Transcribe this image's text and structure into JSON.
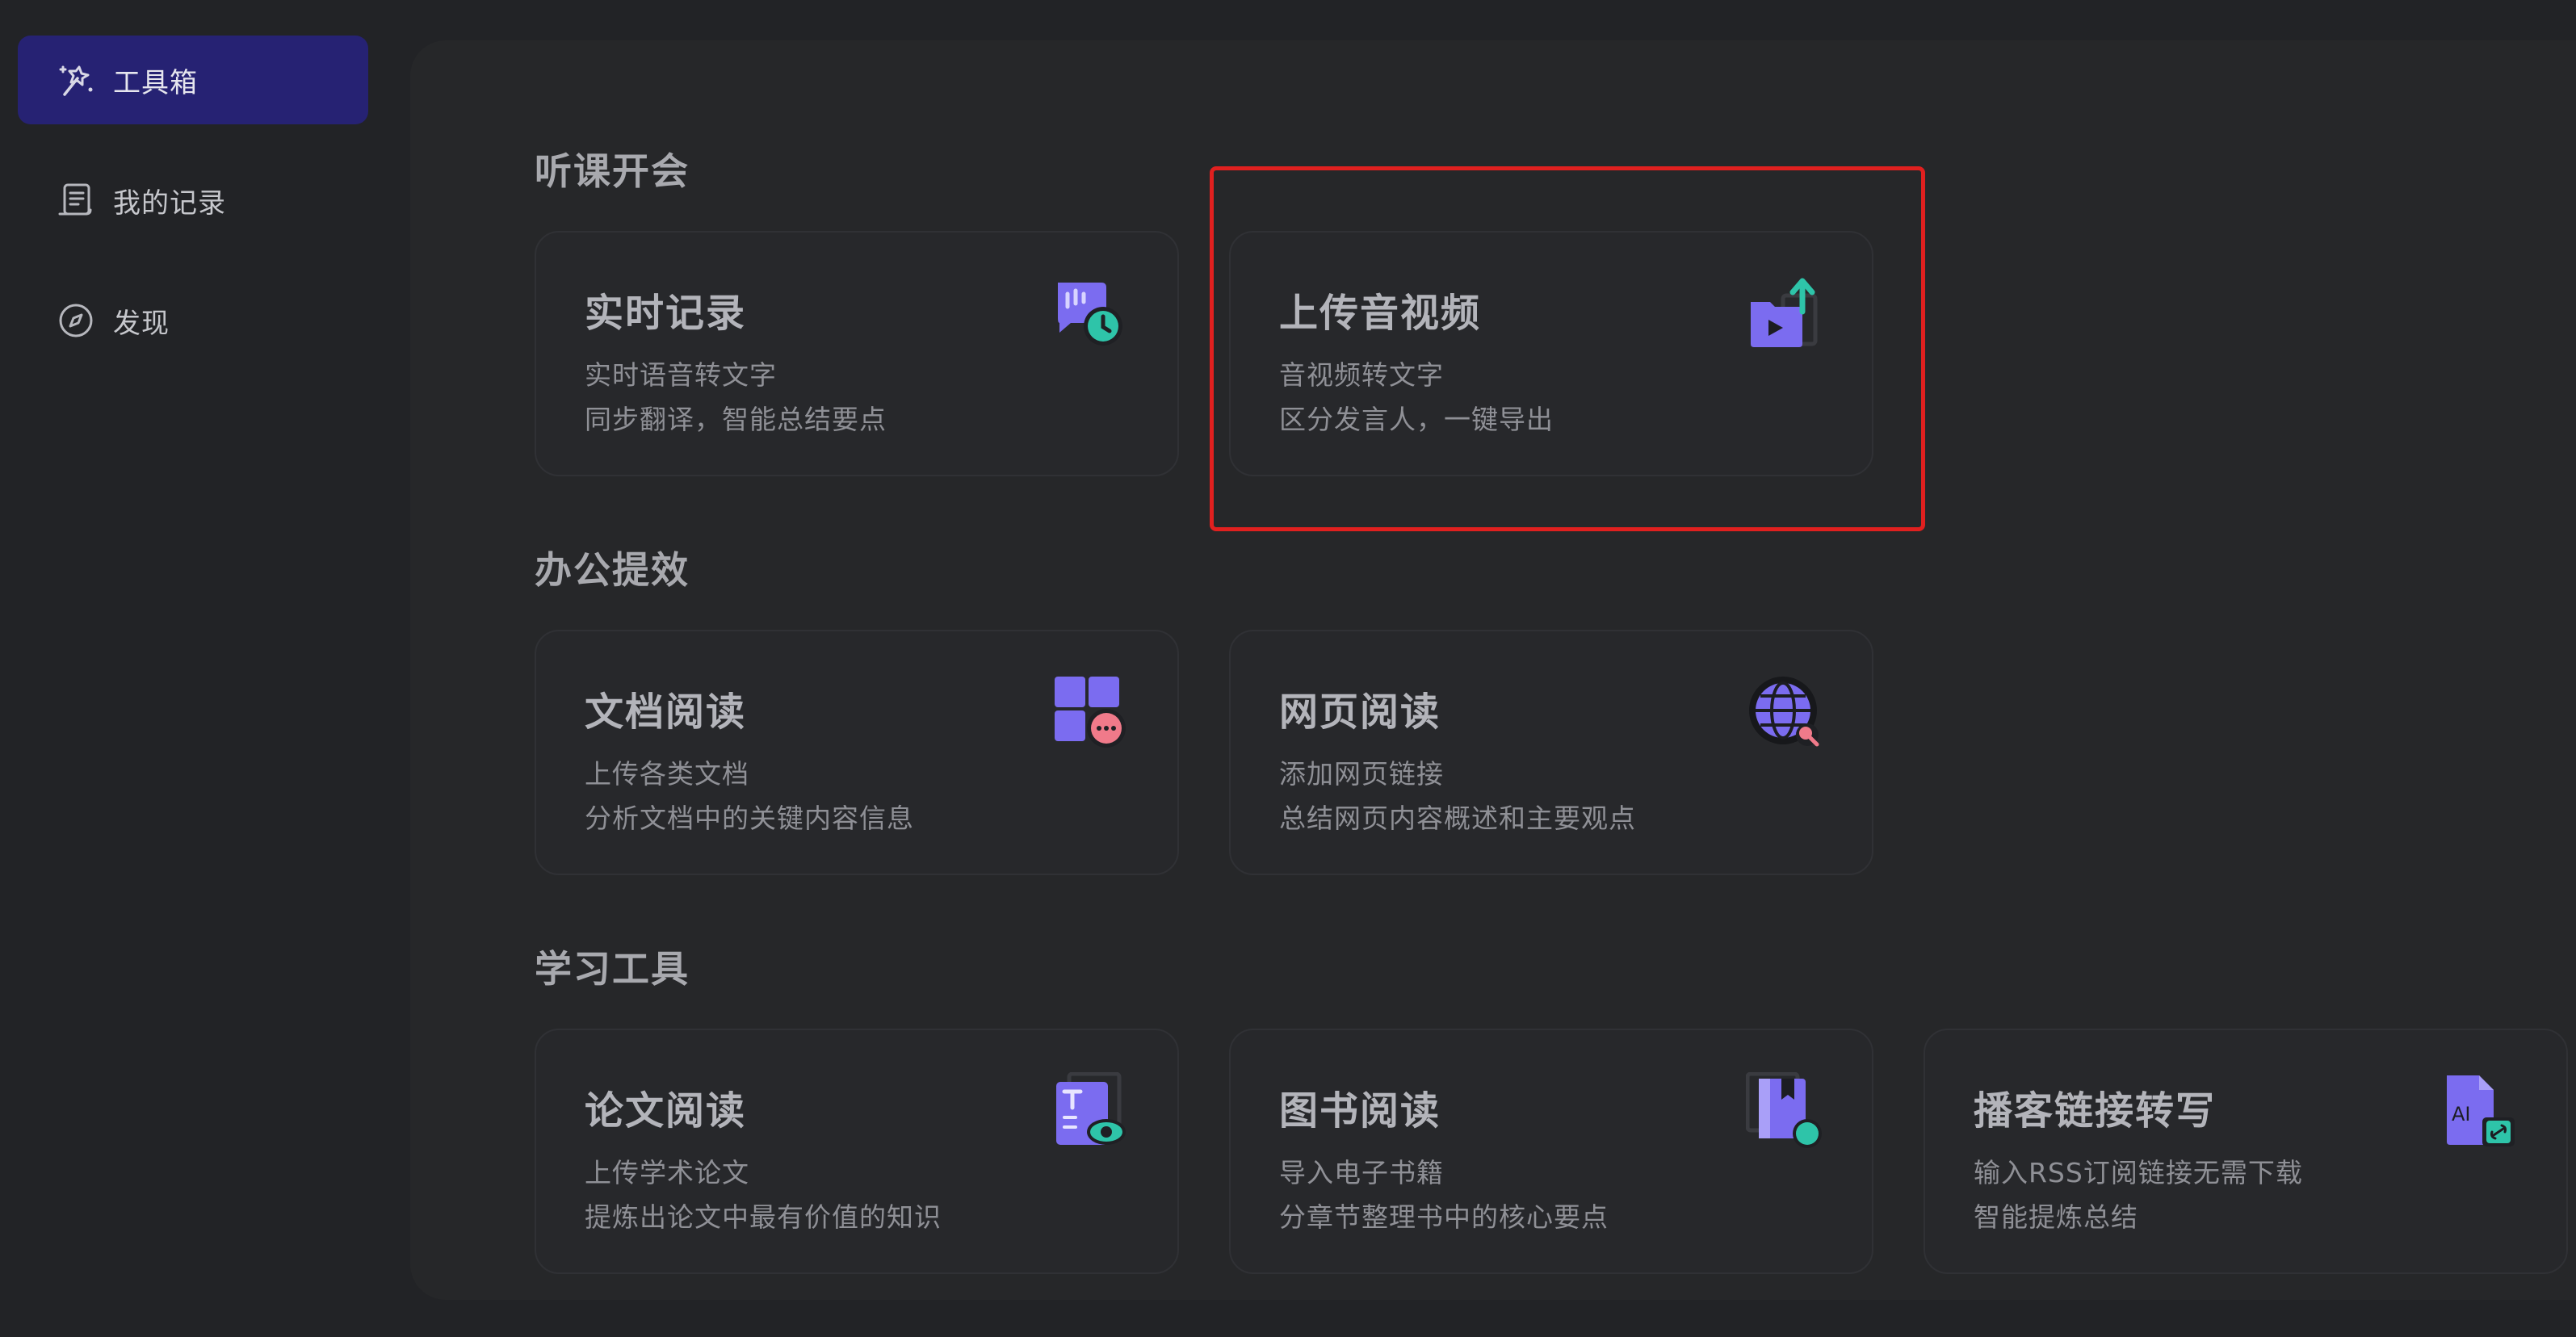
{
  "sidebar": {
    "items": [
      {
        "label": "工具箱",
        "icon": "magic-wand-icon",
        "active": true
      },
      {
        "label": "我的记录",
        "icon": "scroll-icon",
        "active": false
      },
      {
        "label": "发现",
        "icon": "compass-icon",
        "active": false
      }
    ]
  },
  "sections": [
    {
      "title": "听课开会",
      "cards": [
        {
          "title": "实时记录",
          "line1": "实时语音转文字",
          "line2": "同步翻译，智能总结要点",
          "icon": "chat-clock-icon"
        },
        {
          "title": "上传音视频",
          "line1": "音视频转文字",
          "line2": "区分发言人，一键导出",
          "icon": "upload-video-icon"
        }
      ]
    },
    {
      "title": "办公提效",
      "cards": [
        {
          "title": "文档阅读",
          "line1": "上传各类文档",
          "line2": "分析文档中的关键内容信息",
          "icon": "doc-grid-icon"
        },
        {
          "title": "网页阅读",
          "line1": "添加网页链接",
          "line2": "总结网页内容概述和主要观点",
          "icon": "globe-search-icon"
        }
      ]
    },
    {
      "title": "学习工具",
      "cards": [
        {
          "title": "论文阅读",
          "line1": "上传学术论文",
          "line2": "提炼出论文中最有价值的知识",
          "icon": "paper-eye-icon"
        },
        {
          "title": "图书阅读",
          "line1": "导入电子书籍",
          "line2": "分章节整理书中的核心要点",
          "icon": "bookmark-book-icon"
        },
        {
          "title": "播客链接转写",
          "line1": "输入RSS订阅链接无需下载",
          "line2": "智能提炼总结",
          "icon": "ai-file-link-icon"
        }
      ]
    }
  ],
  "colors": {
    "background": "#222326",
    "panel": "#262729",
    "active_nav": "#262273",
    "accent_purple": "#7b6cf0",
    "accent_teal": "#2ec4a9",
    "highlight": "#e0201f"
  }
}
